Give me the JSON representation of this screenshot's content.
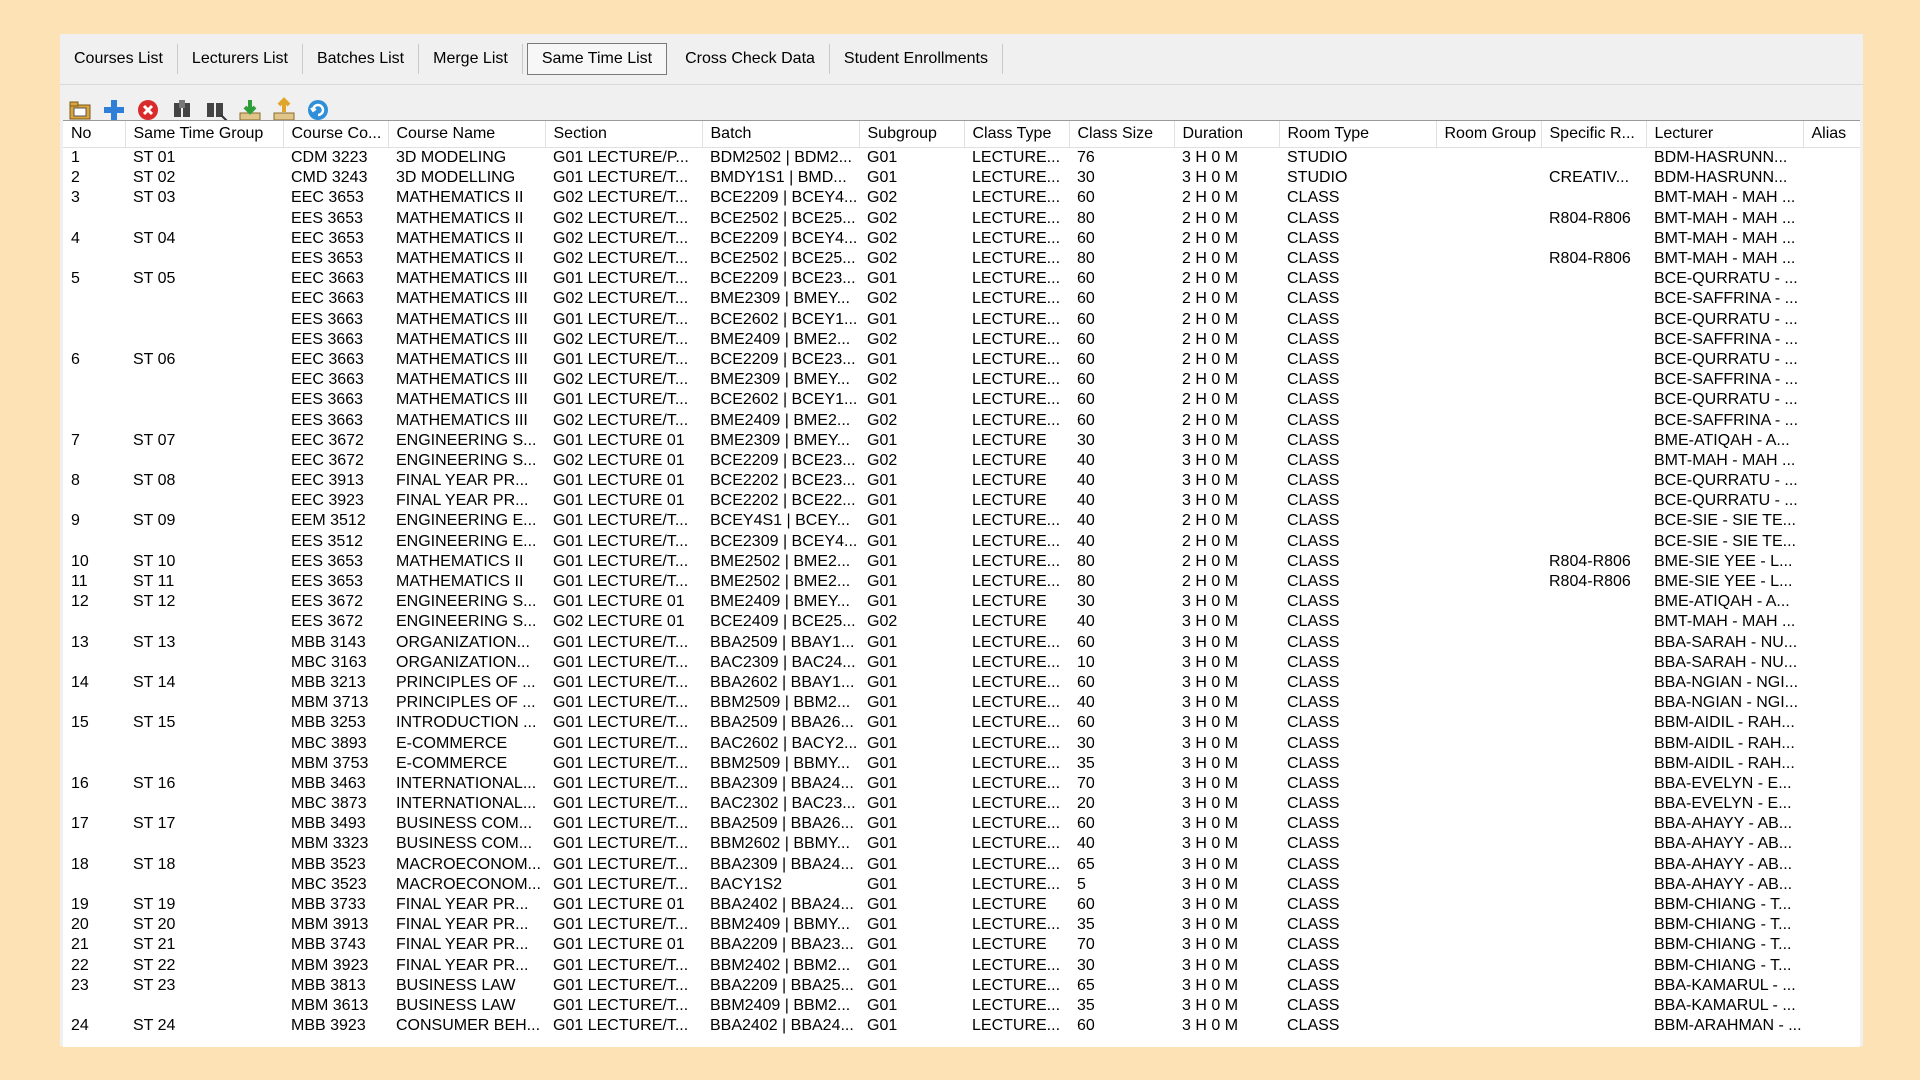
{
  "tabs": [
    "Courses List",
    "Lecturers List",
    "Batches List",
    "Merge List",
    "Same Time List",
    "Cross Check Data",
    "Student Enrollments"
  ],
  "active_tab": "Same Time List",
  "toolbar": [
    {
      "name": "open-folder-icon",
      "color": "#D9A441"
    },
    {
      "name": "add-icon",
      "color": "#2F7ED8"
    },
    {
      "name": "delete-icon",
      "color": "#D92B2B"
    },
    {
      "name": "find-icon",
      "color": "#444444"
    },
    {
      "name": "find-replace-icon",
      "color": "#444444"
    },
    {
      "name": "import-icon",
      "color": "#2E9E3A"
    },
    {
      "name": "export-icon",
      "color": "#E0A52B"
    },
    {
      "name": "refresh-icon",
      "color": "#2F8FD8"
    }
  ],
  "columns": [
    "No",
    "Same Time Group",
    "Course Co...",
    "Course Name",
    "Section",
    "Batch",
    "Subgroup",
    "Class Type",
    "Class Size",
    "Duration",
    "Room Type",
    "Room Group",
    "Specific R...",
    "Lecturer",
    "Alias"
  ],
  "rows": [
    [
      "1",
      "ST 01",
      "CDM 3223",
      "3D MODELING",
      "G01 LECTURE/P...",
      "BDM2502 | BDM2...",
      "G01",
      "LECTURE...",
      "76",
      "3 H 0 M",
      "STUDIO",
      "",
      "",
      "BDM-HASRUNN...",
      ""
    ],
    [
      "2",
      "ST 02",
      "CMD 3243",
      "3D MODELLING",
      "G01 LECTURE/T...",
      "BMDY1S1 | BMD...",
      "G01",
      "LECTURE...",
      "30",
      "3 H 0 M",
      "STUDIO",
      "",
      "CREATIV...",
      "BDM-HASRUNN...",
      ""
    ],
    [
      "3",
      "ST 03",
      "EEC 3653",
      "MATHEMATICS II",
      "G02 LECTURE/T...",
      "BCE2209 | BCEY4...",
      "G02",
      "LECTURE...",
      "60",
      "2 H 0 M",
      "CLASS",
      "",
      "",
      "BMT-MAH - MAH ...",
      ""
    ],
    [
      "",
      "",
      "EES 3653",
      "MATHEMATICS II",
      "G02 LECTURE/T...",
      "BCE2502 | BCE25...",
      "G02",
      "LECTURE...",
      "80",
      "2 H 0 M",
      "CLASS",
      "",
      "R804-R806",
      "BMT-MAH - MAH ...",
      ""
    ],
    [
      "4",
      "ST 04",
      "EEC 3653",
      "MATHEMATICS II",
      "G02 LECTURE/T...",
      "BCE2209 | BCEY4...",
      "G02",
      "LECTURE...",
      "60",
      "2 H 0 M",
      "CLASS",
      "",
      "",
      "BMT-MAH - MAH ...",
      ""
    ],
    [
      "",
      "",
      "EES 3653",
      "MATHEMATICS II",
      "G02 LECTURE/T...",
      "BCE2502 | BCE25...",
      "G02",
      "LECTURE...",
      "80",
      "2 H 0 M",
      "CLASS",
      "",
      "R804-R806",
      "BMT-MAH - MAH ...",
      ""
    ],
    [
      "5",
      "ST 05",
      "EEC 3663",
      "MATHEMATICS III",
      "G01 LECTURE/T...",
      "BCE2209 | BCE23...",
      "G01",
      "LECTURE...",
      "60",
      "2 H 0 M",
      "CLASS",
      "",
      "",
      "BCE-QURRATU - ...",
      ""
    ],
    [
      "",
      "",
      "EEC 3663",
      "MATHEMATICS III",
      "G02 LECTURE/T...",
      "BME2309 | BMEY...",
      "G02",
      "LECTURE...",
      "60",
      "2 H 0 M",
      "CLASS",
      "",
      "",
      "BCE-SAFFRINA - ...",
      ""
    ],
    [
      "",
      "",
      "EES 3663",
      "MATHEMATICS III",
      "G01 LECTURE/T...",
      "BCE2602 | BCEY1...",
      "G01",
      "LECTURE...",
      "60",
      "2 H 0 M",
      "CLASS",
      "",
      "",
      "BCE-QURRATU - ...",
      ""
    ],
    [
      "",
      "",
      "EES 3663",
      "MATHEMATICS III",
      "G02 LECTURE/T...",
      "BME2409 | BME2...",
      "G02",
      "LECTURE...",
      "60",
      "2 H 0 M",
      "CLASS",
      "",
      "",
      "BCE-SAFFRINA - ...",
      ""
    ],
    [
      "6",
      "ST 06",
      "EEC 3663",
      "MATHEMATICS III",
      "G01 LECTURE/T...",
      "BCE2209 | BCE23...",
      "G01",
      "LECTURE...",
      "60",
      "2 H 0 M",
      "CLASS",
      "",
      "",
      "BCE-QURRATU - ...",
      ""
    ],
    [
      "",
      "",
      "EEC 3663",
      "MATHEMATICS III",
      "G02 LECTURE/T...",
      "BME2309 | BMEY...",
      "G02",
      "LECTURE...",
      "60",
      "2 H 0 M",
      "CLASS",
      "",
      "",
      "BCE-SAFFRINA - ...",
      ""
    ],
    [
      "",
      "",
      "EES 3663",
      "MATHEMATICS III",
      "G01 LECTURE/T...",
      "BCE2602 | BCEY1...",
      "G01",
      "LECTURE...",
      "60",
      "2 H 0 M",
      "CLASS",
      "",
      "",
      "BCE-QURRATU - ...",
      ""
    ],
    [
      "",
      "",
      "EES 3663",
      "MATHEMATICS III",
      "G02 LECTURE/T...",
      "BME2409 | BME2...",
      "G02",
      "LECTURE...",
      "60",
      "2 H 0 M",
      "CLASS",
      "",
      "",
      "BCE-SAFFRINA - ...",
      ""
    ],
    [
      "7",
      "ST 07",
      "EEC 3672",
      "ENGINEERING S...",
      "G01 LECTURE 01",
      "BME2309 | BMEY...",
      "G01",
      "LECTURE",
      "30",
      "3 H 0 M",
      "CLASS",
      "",
      "",
      "BME-ATIQAH - A...",
      ""
    ],
    [
      "",
      "",
      "EEC 3672",
      "ENGINEERING S...",
      "G02 LECTURE 01",
      "BCE2209 | BCE23...",
      "G02",
      "LECTURE",
      "40",
      "3 H 0 M",
      "CLASS",
      "",
      "",
      "BMT-MAH - MAH ...",
      ""
    ],
    [
      "8",
      "ST 08",
      "EEC 3913",
      "FINAL YEAR PR...",
      "G01 LECTURE 01",
      "BCE2202 | BCE23...",
      "G01",
      "LECTURE",
      "40",
      "3 H 0 M",
      "CLASS",
      "",
      "",
      "BCE-QURRATU - ...",
      ""
    ],
    [
      "",
      "",
      "EEC 3923",
      "FINAL YEAR PR...",
      "G01 LECTURE 01",
      "BCE2202 | BCE22...",
      "G01",
      "LECTURE",
      "40",
      "3 H 0 M",
      "CLASS",
      "",
      "",
      "BCE-QURRATU - ...",
      ""
    ],
    [
      "9",
      "ST 09",
      "EEM 3512",
      "ENGINEERING E...",
      "G01 LECTURE/T...",
      "BCEY4S1 | BCEY...",
      "G01",
      "LECTURE...",
      "40",
      "2 H 0 M",
      "CLASS",
      "",
      "",
      "BCE-SIE - SIE TE...",
      ""
    ],
    [
      "",
      "",
      "EES 3512",
      "ENGINEERING E...",
      "G01 LECTURE/T...",
      "BCE2309 | BCEY4...",
      "G01",
      "LECTURE...",
      "40",
      "2 H 0 M",
      "CLASS",
      "",
      "",
      "BCE-SIE - SIE TE...",
      ""
    ],
    [
      "10",
      "ST 10",
      "EES 3653",
      "MATHEMATICS II",
      "G01 LECTURE/T...",
      "BME2502 | BME2...",
      "G01",
      "LECTURE...",
      "80",
      "2 H 0 M",
      "CLASS",
      "",
      "R804-R806",
      "BME-SIE YEE - L...",
      ""
    ],
    [
      "11",
      "ST 11",
      "EES 3653",
      "MATHEMATICS II",
      "G01 LECTURE/T...",
      "BME2502 | BME2...",
      "G01",
      "LECTURE...",
      "80",
      "2 H 0 M",
      "CLASS",
      "",
      "R804-R806",
      "BME-SIE YEE - L...",
      ""
    ],
    [
      "12",
      "ST 12",
      "EES 3672",
      "ENGINEERING S...",
      "G01 LECTURE 01",
      "BME2409 | BMEY...",
      "G01",
      "LECTURE",
      "30",
      "3 H 0 M",
      "CLASS",
      "",
      "",
      "BME-ATIQAH - A...",
      ""
    ],
    [
      "",
      "",
      "EES 3672",
      "ENGINEERING S...",
      "G02 LECTURE 01",
      "BCE2409 | BCE25...",
      "G02",
      "LECTURE",
      "40",
      "3 H 0 M",
      "CLASS",
      "",
      "",
      "BMT-MAH - MAH ...",
      ""
    ],
    [
      "13",
      "ST 13",
      "MBB 3143",
      "ORGANIZATION...",
      "G01 LECTURE/T...",
      "BBA2509 | BBAY1...",
      "G01",
      "LECTURE...",
      "60",
      "3 H 0 M",
      "CLASS",
      "",
      "",
      "BBA-SARAH - NU...",
      ""
    ],
    [
      "",
      "",
      "MBC 3163",
      "ORGANIZATION...",
      "G01 LECTURE/T...",
      "BAC2309 | BAC24...",
      "G01",
      "LECTURE...",
      "10",
      "3 H 0 M",
      "CLASS",
      "",
      "",
      "BBA-SARAH - NU...",
      ""
    ],
    [
      "14",
      "ST 14",
      "MBB 3213",
      "PRINCIPLES OF ...",
      "G01 LECTURE/T...",
      "BBA2602 | BBAY1...",
      "G01",
      "LECTURE...",
      "60",
      "3 H 0 M",
      "CLASS",
      "",
      "",
      "BBA-NGIAN - NGI...",
      ""
    ],
    [
      "",
      "",
      "MBM 3713",
      "PRINCIPLES OF ...",
      "G01 LECTURE/T...",
      "BBM2509 | BBM2...",
      "G01",
      "LECTURE...",
      "40",
      "3 H 0 M",
      "CLASS",
      "",
      "",
      "BBA-NGIAN - NGI...",
      ""
    ],
    [
      "15",
      "ST 15",
      "MBB 3253",
      "INTRODUCTION ...",
      "G01 LECTURE/T...",
      "BBA2509 | BBA26...",
      "G01",
      "LECTURE...",
      "60",
      "3 H 0 M",
      "CLASS",
      "",
      "",
      "BBM-AIDIL - RAH...",
      ""
    ],
    [
      "",
      "",
      "MBC 3893",
      "E-COMMERCE",
      "G01 LECTURE/T...",
      "BAC2602 | BACY2...",
      "G01",
      "LECTURE...",
      "30",
      "3 H 0 M",
      "CLASS",
      "",
      "",
      "BBM-AIDIL - RAH...",
      ""
    ],
    [
      "",
      "",
      "MBM 3753",
      "E-COMMERCE",
      "G01 LECTURE/T...",
      "BBM2509 | BBMY...",
      "G01",
      "LECTURE...",
      "35",
      "3 H 0 M",
      "CLASS",
      "",
      "",
      "BBM-AIDIL - RAH...",
      ""
    ],
    [
      "16",
      "ST 16",
      "MBB 3463",
      "INTERNATIONAL...",
      "G01 LECTURE/T...",
      "BBA2309 | BBA24...",
      "G01",
      "LECTURE...",
      "70",
      "3 H 0 M",
      "CLASS",
      "",
      "",
      "BBA-EVELYN - E...",
      ""
    ],
    [
      "",
      "",
      "MBC 3873",
      "INTERNATIONAL...",
      "G01 LECTURE/T...",
      "BAC2302 | BAC23...",
      "G01",
      "LECTURE...",
      "20",
      "3 H 0 M",
      "CLASS",
      "",
      "",
      "BBA-EVELYN - E...",
      ""
    ],
    [
      "17",
      "ST 17",
      "MBB 3493",
      "BUSINESS COM...",
      "G01 LECTURE/T...",
      "BBA2509 | BBA26...",
      "G01",
      "LECTURE...",
      "60",
      "3 H 0 M",
      "CLASS",
      "",
      "",
      "BBA-AHAYY - AB...",
      ""
    ],
    [
      "",
      "",
      "MBM 3323",
      "BUSINESS COM...",
      "G01 LECTURE/T...",
      "BBM2602 | BBMY...",
      "G01",
      "LECTURE...",
      "40",
      "3 H 0 M",
      "CLASS",
      "",
      "",
      "BBA-AHAYY - AB...",
      ""
    ],
    [
      "18",
      "ST 18",
      "MBB 3523",
      "MACROECONOM...",
      "G01 LECTURE/T...",
      "BBA2309 | BBA24...",
      "G01",
      "LECTURE...",
      "65",
      "3 H 0 M",
      "CLASS",
      "",
      "",
      "BBA-AHAYY - AB...",
      ""
    ],
    [
      "",
      "",
      "MBC 3523",
      "MACROECONOM...",
      "G01 LECTURE/T...",
      "BACY1S2",
      "G01",
      "LECTURE...",
      "5",
      "3 H 0 M",
      "CLASS",
      "",
      "",
      "BBA-AHAYY - AB...",
      ""
    ],
    [
      "19",
      "ST 19",
      "MBB 3733",
      "FINAL YEAR PR...",
      "G01 LECTURE 01",
      "BBA2402 | BBA24...",
      "G01",
      "LECTURE",
      "60",
      "3 H 0 M",
      "CLASS",
      "",
      "",
      "BBM-CHIANG - T...",
      ""
    ],
    [
      "20",
      "ST 20",
      "MBM 3913",
      "FINAL YEAR PR...",
      "G01 LECTURE/T...",
      "BBM2409 | BBMY...",
      "G01",
      "LECTURE...",
      "35",
      "3 H 0 M",
      "CLASS",
      "",
      "",
      "BBM-CHIANG - T...",
      ""
    ],
    [
      "21",
      "ST 21",
      "MBB 3743",
      "FINAL YEAR PR...",
      "G01 LECTURE 01",
      "BBA2209 | BBA23...",
      "G01",
      "LECTURE",
      "70",
      "3 H 0 M",
      "CLASS",
      "",
      "",
      "BBM-CHIANG - T...",
      ""
    ],
    [
      "22",
      "ST 22",
      "MBM 3923",
      "FINAL YEAR PR...",
      "G01 LECTURE/T...",
      "BBM2402 | BBM2...",
      "G01",
      "LECTURE...",
      "30",
      "3 H 0 M",
      "CLASS",
      "",
      "",
      "BBM-CHIANG - T...",
      ""
    ],
    [
      "23",
      "ST 23",
      "MBB 3813",
      "BUSINESS LAW",
      "G01 LECTURE/T...",
      "BBA2209 | BBA25...",
      "G01",
      "LECTURE...",
      "65",
      "3 H 0 M",
      "CLASS",
      "",
      "",
      "BBA-KAMARUL - ...",
      ""
    ],
    [
      "",
      "",
      "MBM 3613",
      "BUSINESS LAW",
      "G01 LECTURE/T...",
      "BBM2409 | BBM2...",
      "G01",
      "LECTURE...",
      "35",
      "3 H 0 M",
      "CLASS",
      "",
      "",
      "BBA-KAMARUL - ...",
      ""
    ],
    [
      "24",
      "ST 24",
      "MBB 3923",
      "CONSUMER BEH...",
      "G01 LECTURE/T...",
      "BBA2402 | BBA24...",
      "G01",
      "LECTURE...",
      "60",
      "3 H 0 M",
      "CLASS",
      "",
      "",
      "BBM-ARAHMAN - ...",
      ""
    ]
  ]
}
